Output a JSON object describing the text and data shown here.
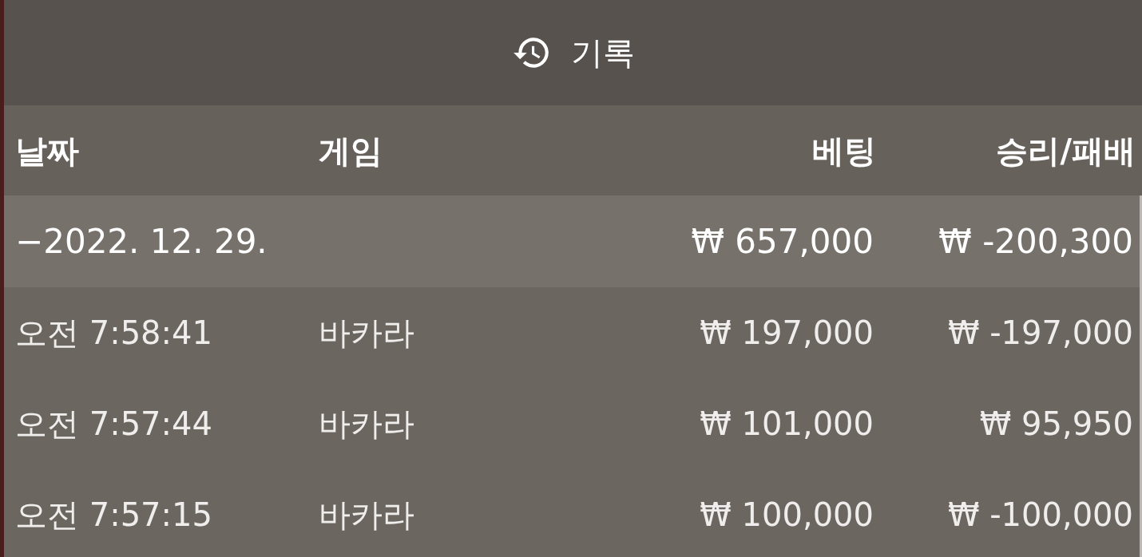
{
  "window": {
    "title": "기록"
  },
  "columns": [
    "날짜",
    "게임",
    "베팅",
    "승리/패배"
  ],
  "group": {
    "date": "−2022. 12. 29.",
    "bet": "₩ 657,000",
    "result": "₩ -200,300"
  },
  "rows": [
    {
      "time": "오전 7:58:41",
      "game": "바카라",
      "bet": "₩ 197,000",
      "result": "₩ -197,000"
    },
    {
      "time": "오전 7:57:44",
      "game": "바카라",
      "bet": "₩ 101,000",
      "result": "₩ 95,950"
    },
    {
      "time": "오전 7:57:15",
      "game": "바카라",
      "bet": "₩ 100,000",
      "result": "₩ -100,000"
    }
  ]
}
